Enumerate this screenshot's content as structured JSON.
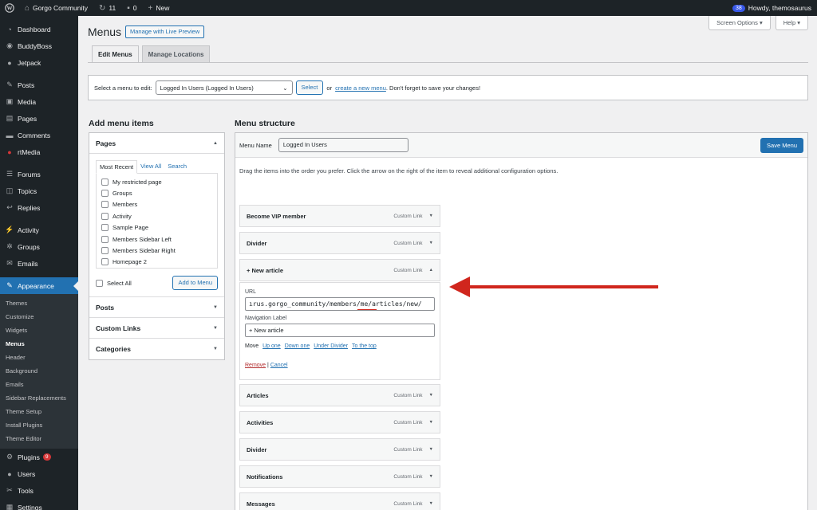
{
  "adminbar": {
    "site_name": "Gorgo Community",
    "updates_count": "11",
    "comments_count": "0",
    "new_label": "New",
    "notif_count": "38",
    "howdy": "Howdy, themosaurus"
  },
  "sidebar": {
    "items": [
      {
        "label": "Dashboard",
        "icon": "dashboard-icon"
      },
      {
        "label": "BuddyBoss",
        "icon": "buddyboss-icon"
      },
      {
        "label": "Jetpack",
        "icon": "jetpack-icon"
      },
      {
        "label": "Posts",
        "icon": "pin-icon"
      },
      {
        "label": "Media",
        "icon": "media-icon"
      },
      {
        "label": "Pages",
        "icon": "pages-icon"
      },
      {
        "label": "Comments",
        "icon": "comments-icon"
      },
      {
        "label": "rtMedia",
        "icon": "rtmedia-icon"
      },
      {
        "label": "Forums",
        "icon": "forums-icon"
      },
      {
        "label": "Topics",
        "icon": "topics-icon"
      },
      {
        "label": "Replies",
        "icon": "replies-icon"
      },
      {
        "label": "Activity",
        "icon": "activity-icon"
      },
      {
        "label": "Groups",
        "icon": "groups-icon"
      },
      {
        "label": "Emails",
        "icon": "emails-icon"
      },
      {
        "label": "Appearance",
        "icon": "appearance-icon"
      }
    ],
    "submenu": [
      "Themes",
      "Customize",
      "Widgets",
      "Menus",
      "Header",
      "Background",
      "Emails",
      "Sidebar Replacements",
      "Theme Setup",
      "Install Plugins",
      "Theme Editor"
    ],
    "bottom_items": [
      {
        "label": "Plugins",
        "icon": "plugins-icon",
        "badge": "9"
      },
      {
        "label": "Users",
        "icon": "users-icon"
      },
      {
        "label": "Tools",
        "icon": "tools-icon"
      },
      {
        "label": "Settings",
        "icon": "settings-icon"
      }
    ]
  },
  "header": {
    "title": "Menus",
    "live_preview": "Manage with Live Preview",
    "screen_options": "Screen Options",
    "help": "Help"
  },
  "tabs": [
    "Edit Menus",
    "Manage Locations"
  ],
  "select_bar": {
    "label": "Select a menu to edit:",
    "selected": "Logged In Users (Logged In Users)",
    "select_button": "Select",
    "or": "or",
    "create_link": "create a new menu",
    "tail": ". Don't forget to save your changes!"
  },
  "add_items": {
    "title": "Add menu items",
    "pages_title": "Pages",
    "inner_tabs": [
      "Most Recent",
      "View All",
      "Search"
    ],
    "pages": [
      "My restricted page",
      "Groups",
      "Members",
      "Activity",
      "Sample Page",
      "Members Sidebar Left",
      "Members Sidebar Right",
      "Homepage 2"
    ],
    "select_all": "Select All",
    "add_button": "Add to Menu",
    "closed_sections": [
      "Posts",
      "Custom Links",
      "Categories"
    ]
  },
  "structure": {
    "title": "Menu structure",
    "name_label": "Menu Name",
    "name_value": "Logged In Users",
    "save_button": "Save Menu",
    "instructions": "Drag the items into the order you prefer. Click the arrow on the right of the item to reveal additional configuration options.",
    "items_top": [
      {
        "title": "Become VIP member",
        "type": "Custom Link"
      },
      {
        "title": "Divider",
        "type": "Custom Link"
      },
      {
        "title": "+ New article",
        "type": "Custom Link"
      }
    ],
    "open_item": {
      "url_label": "URL",
      "url_value": "ırus.gorgo_community/members/me/articles/new/",
      "nav_label": "Navigation Label",
      "nav_value": "+ New article",
      "move_label": "Move",
      "move_links": [
        "Up one",
        "Down one",
        "Under Divider",
        "To the top"
      ],
      "remove": "Remove",
      "separator": "|",
      "cancel": "Cancel"
    },
    "items_bottom": [
      {
        "title": "Articles",
        "type": "Custom Link"
      },
      {
        "title": "Activities",
        "type": "Custom Link"
      },
      {
        "title": "Divider",
        "type": "Custom Link"
      },
      {
        "title": "Notifications",
        "type": "Custom Link"
      },
      {
        "title": "Messages",
        "type": "Custom Link"
      }
    ]
  },
  "colors": {
    "admin_dark": "#1d2327",
    "accent": "#2271b1",
    "annotation_red": "#d0261d"
  }
}
